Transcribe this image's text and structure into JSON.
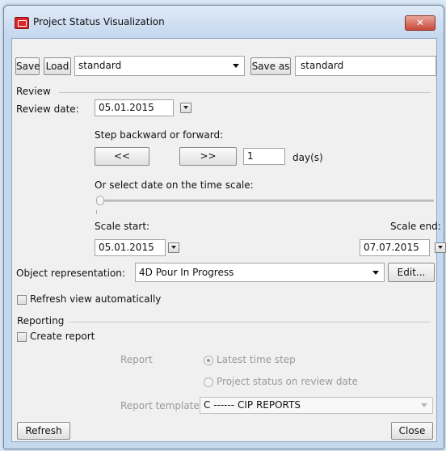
{
  "window": {
    "title": "Project Status Visualization",
    "close_label": "✕"
  },
  "top_row": {
    "save_label": "Save",
    "load_label": "Load",
    "profile_value": "standard",
    "save_as_label": "Save as",
    "save_as_value": "standard"
  },
  "review": {
    "group_label": "Review",
    "date_label": "Review date:",
    "date_value": "05.01.2015",
    "step_label": "Step backward or forward:",
    "back_label": "<<",
    "forward_label": ">>",
    "step_value": "1",
    "step_unit": "day(s)",
    "scale_hint": "Or select date on the time scale:",
    "slider_position": 0.0,
    "scale_start_label": "Scale start:",
    "scale_start_value": "05.01.2015",
    "scale_end_label": "Scale end:",
    "scale_end_value": "07.07.2015"
  },
  "object_representation": {
    "label": "Object representation:",
    "value": "4D Pour In Progress",
    "edit_label": "Edit..."
  },
  "refresh_auto": {
    "label": "Refresh view automatically",
    "checked": false
  },
  "reporting": {
    "group_label": "Reporting",
    "create_report_label": "Create report",
    "create_report_checked": false,
    "report_label": "Report",
    "option_latest": "Latest time step",
    "option_status": "Project status on review date",
    "template_label": "Report template:",
    "template_value": "C ------ CIP REPORTS"
  },
  "footer": {
    "refresh_label": "Refresh",
    "close_label": "Close"
  }
}
